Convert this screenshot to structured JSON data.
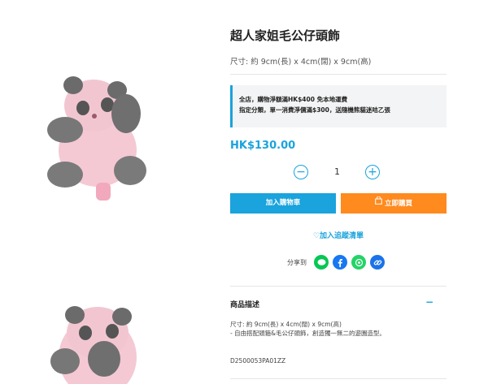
{
  "product": {
    "title": "超人家姐毛公仔頭飾",
    "size": "尺寸: 約 9cm(長) x 4cm(闊) x 9cm(高)",
    "promo_line1": "全店，購物淨額滿HK$400 免本地運費",
    "promo_line2": "指定分類，單一消費淨價滿$300，送隨機熊貓迷咭乙張",
    "price": "HK$130.00",
    "quantity": "1",
    "minus_symbol": "−",
    "plus_symbol": "+"
  },
  "actions": {
    "add_to_cart": "加入購物車",
    "buy_now": "立即購買",
    "wishlist_heart": "♡",
    "wishlist": "加入追蹤清單"
  },
  "share": {
    "label": "分享到",
    "icons": [
      "line-icon",
      "facebook-icon",
      "whatsapp-icon",
      "link-icon"
    ],
    "colors": {
      "line": "#06c755",
      "facebook": "#1877f2",
      "whatsapp": "#25d366",
      "link": "#1a73e8"
    }
  },
  "description": {
    "title": "商品描述",
    "toggle": "−",
    "line1": "尺寸: 約 9cm(長) x 4cm(闊) x 9cm(高)",
    "line2": "- 自由搭配頭箍&毛公仔頭飾，創造獨一無二的遊園造型。",
    "sku": "D2500053PA01ZZ"
  },
  "colors": {
    "accent": "#1aa3dc",
    "buy": "#ff8a1e"
  }
}
